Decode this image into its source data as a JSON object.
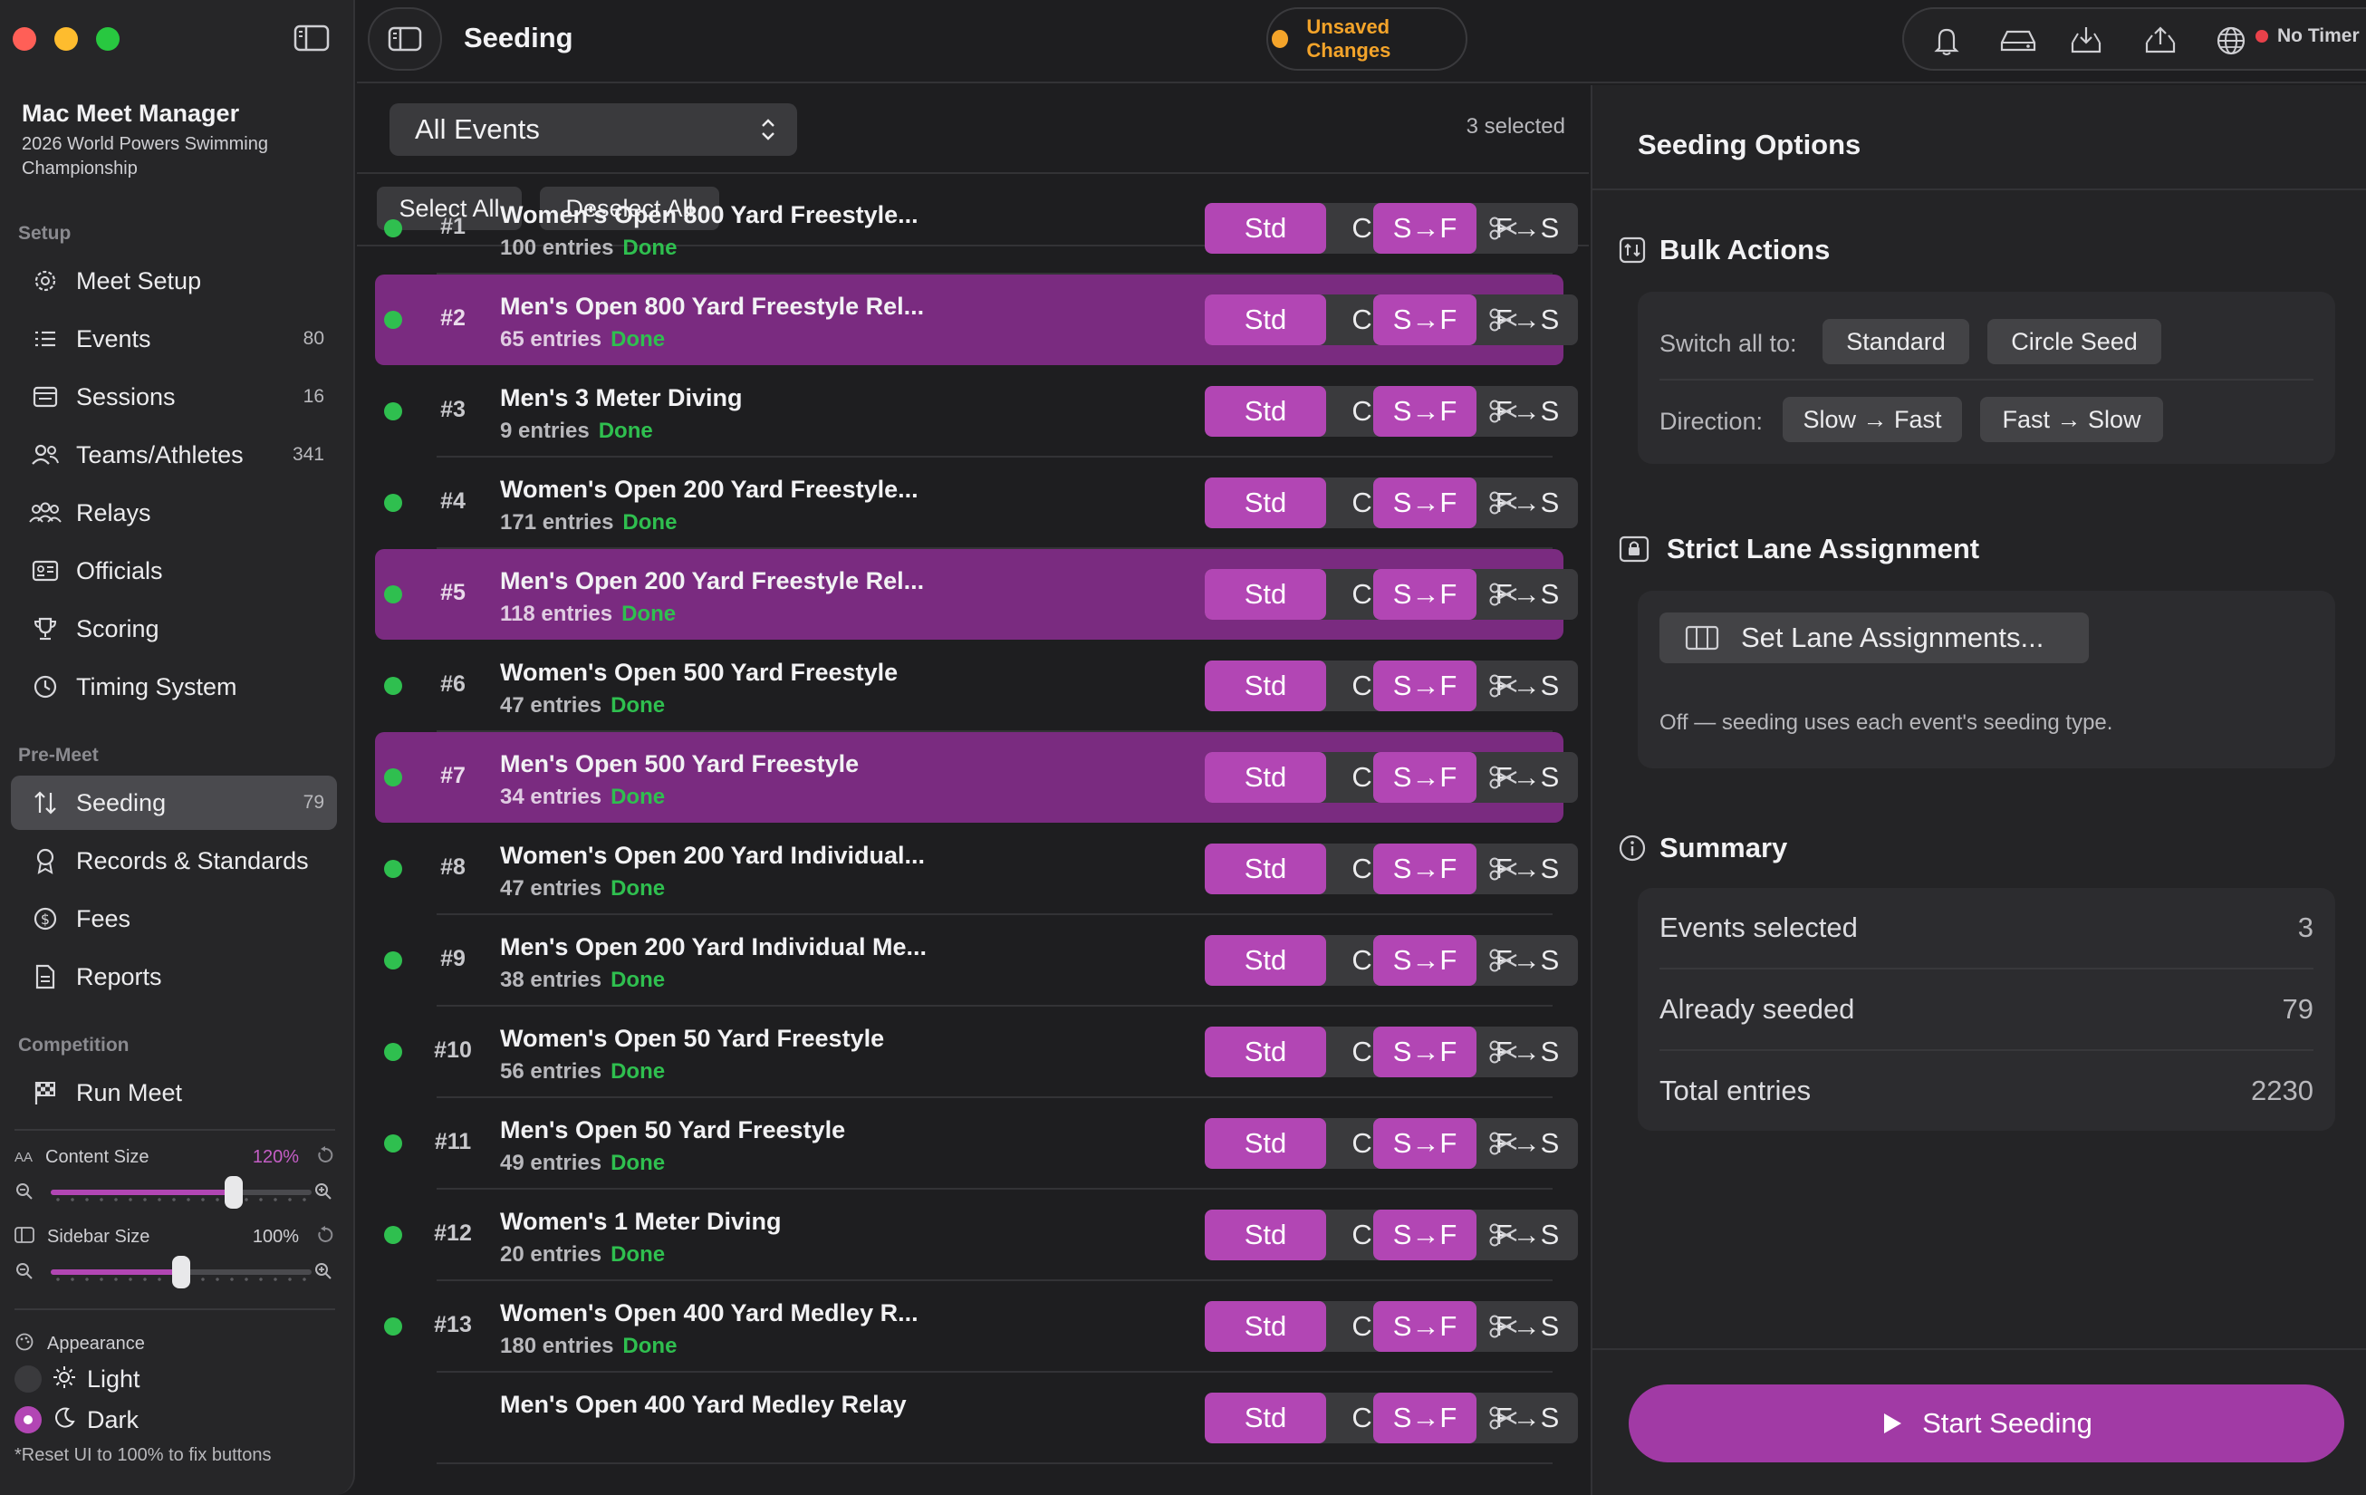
{
  "app": {
    "title": "Mac Meet Manager",
    "subtitle": "2026 World Powers Swimming Championship"
  },
  "sidebar": {
    "sections": {
      "setup": "Setup",
      "premeet": "Pre-Meet",
      "competition": "Competition"
    },
    "items": [
      {
        "label": "Meet Setup",
        "count": "",
        "icon": "gear-icon"
      },
      {
        "label": "Events",
        "count": "80",
        "icon": "list-icon"
      },
      {
        "label": "Sessions",
        "count": "16",
        "icon": "calendar-list-icon"
      },
      {
        "label": "Teams/Athletes",
        "count": "341",
        "icon": "people-icon"
      },
      {
        "label": "Relays",
        "count": "",
        "icon": "group-icon"
      },
      {
        "label": "Officials",
        "count": "",
        "icon": "id-card-icon"
      },
      {
        "label": "Scoring",
        "count": "",
        "icon": "trophy-icon"
      },
      {
        "label": "Timing System",
        "count": "",
        "icon": "timer-icon"
      },
      {
        "label": "Seeding",
        "count": "79",
        "icon": "sort-arrows-icon"
      },
      {
        "label": "Records & Standards",
        "count": "",
        "icon": "ribbon-icon"
      },
      {
        "label": "Fees",
        "count": "",
        "icon": "dollar-icon"
      },
      {
        "label": "Reports",
        "count": "",
        "icon": "document-icon"
      },
      {
        "label": "Run Meet",
        "count": "",
        "icon": "checkered-flag-icon"
      }
    ],
    "content_size": {
      "label": "Content Size",
      "value": "120%",
      "level": 0.7
    },
    "sidebar_size": {
      "label": "Sidebar Size",
      "value": "100%",
      "level": 0.5
    },
    "appearance": {
      "label": "Appearance",
      "light": "Light",
      "dark": "Dark",
      "selected": "Dark"
    },
    "reset_note": "*Reset UI to 100% to fix buttons"
  },
  "topbar": {
    "title": "Seeding",
    "unsaved": "Unsaved Changes",
    "timer": "No Timer"
  },
  "center": {
    "filter": "All Events",
    "selected_count": "3 selected",
    "select_all": "Select All",
    "deselect_all": "Deselect All",
    "seg_labels": {
      "std": "Std",
      "circle": "Circle",
      "sf": "S→F",
      "fs": "F→S"
    },
    "events": [
      {
        "num": "#1",
        "name": "Women's Open 800 Yard Freestyle...",
        "entries": "100 entries",
        "status": "Done",
        "selected": false
      },
      {
        "num": "#2",
        "name": "Men's Open 800 Yard Freestyle Rel...",
        "entries": "65 entries",
        "status": "Done",
        "selected": true
      },
      {
        "num": "#3",
        "name": "Men's 3 Meter Diving",
        "entries": "9 entries",
        "status": "Done",
        "selected": false
      },
      {
        "num": "#4",
        "name": "Women's Open 200 Yard Freestyle...",
        "entries": "171 entries",
        "status": "Done",
        "selected": false
      },
      {
        "num": "#5",
        "name": "Men's Open 200 Yard Freestyle Rel...",
        "entries": "118 entries",
        "status": "Done",
        "selected": true
      },
      {
        "num": "#6",
        "name": "Women's Open 500 Yard Freestyle",
        "entries": "47 entries",
        "status": "Done",
        "selected": false
      },
      {
        "num": "#7",
        "name": "Men's Open 500 Yard Freestyle",
        "entries": "34 entries",
        "status": "Done",
        "selected": true
      },
      {
        "num": "#8",
        "name": "Women's Open 200 Yard Individual...",
        "entries": "47 entries",
        "status": "Done",
        "selected": false
      },
      {
        "num": "#9",
        "name": "Men's Open 200 Yard Individual Me...",
        "entries": "38 entries",
        "status": "Done",
        "selected": false
      },
      {
        "num": "#10",
        "name": "Women's Open 50 Yard Freestyle",
        "entries": "56 entries",
        "status": "Done",
        "selected": false
      },
      {
        "num": "#11",
        "name": "Men's Open 50 Yard Freestyle",
        "entries": "49 entries",
        "status": "Done",
        "selected": false
      },
      {
        "num": "#12",
        "name": "Women's 1 Meter Diving",
        "entries": "20 entries",
        "status": "Done",
        "selected": false
      },
      {
        "num": "#13",
        "name": "Women's Open 400 Yard Medley R...",
        "entries": "180 entries",
        "status": "Done",
        "selected": false
      },
      {
        "num": "",
        "name": "Men's Open 400 Yard Medley Relay",
        "entries": "",
        "status": "",
        "selected": false
      }
    ]
  },
  "right": {
    "title": "Seeding Options",
    "bulk": {
      "title": "Bulk Actions",
      "switch_label": "Switch all to:",
      "standard": "Standard",
      "circle_seed": "Circle Seed",
      "direction_label": "Direction:",
      "slow_fast": "Slow → Fast",
      "fast_slow": "Fast → Slow"
    },
    "strict": {
      "title": "Strict Lane Assignment",
      "button": "Set Lane Assignments...",
      "note": "Off — seeding uses each event's seeding type."
    },
    "summary": {
      "title": "Summary",
      "rows": [
        {
          "label": "Events selected",
          "value": "3"
        },
        {
          "label": "Already seeded",
          "value": "79"
        },
        {
          "label": "Total entries",
          "value": "2230"
        }
      ]
    },
    "start": "Start Seeding"
  },
  "colors": {
    "accent": "#b246b4",
    "selected_row": "#7a2b80",
    "done_green": "#2fbf4f",
    "warning": "#f4a42a",
    "timer_red": "#e8414a"
  }
}
